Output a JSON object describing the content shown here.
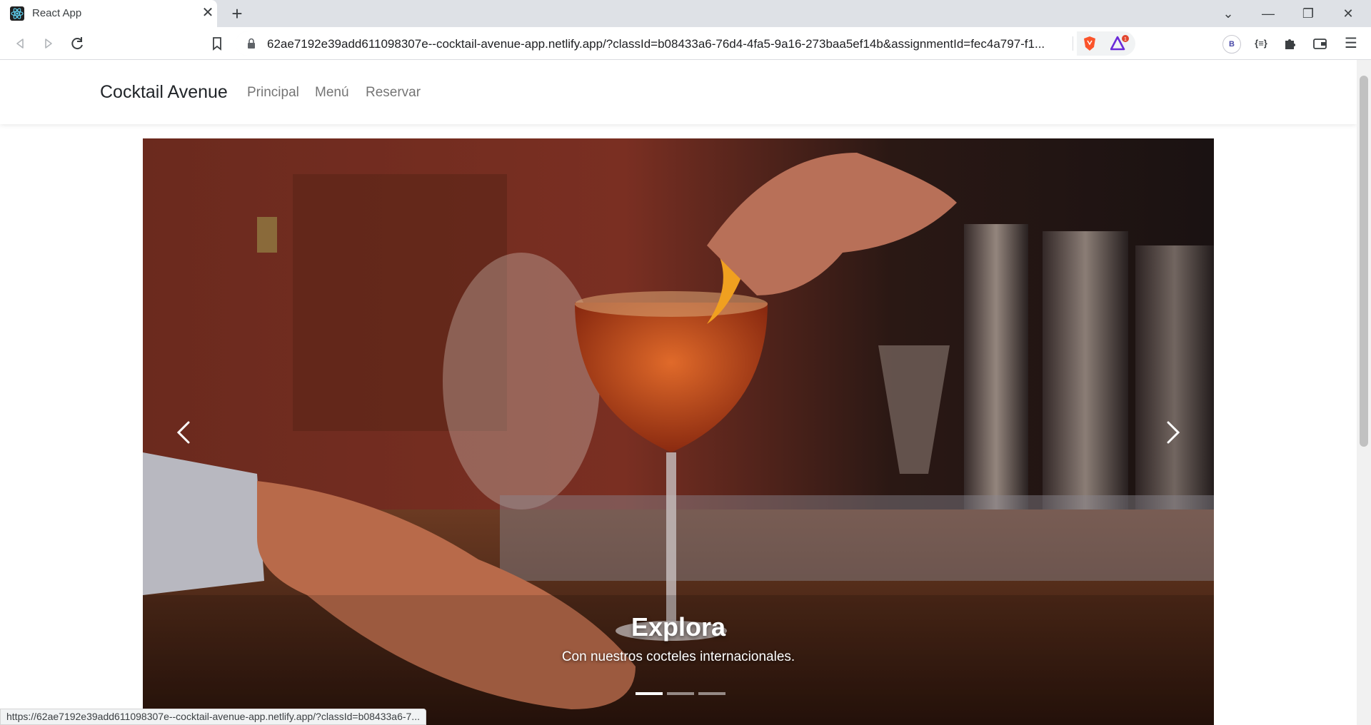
{
  "browser": {
    "tab_title": "React App",
    "url": "62ae7192e39add611098307e--cocktail-avenue-app.netlify.app/?classId=b08433a6-76d4-4fa5-9a16-273baa5ef14b&assignmentId=fec4a797-f1...",
    "rewards_badge": "1",
    "profile_initial": "B",
    "wallet_icon_label": "{≡}",
    "status_url": "https://62ae7192e39add611098307e--cocktail-avenue-app.netlify.app/?classId=b08433a6-7..."
  },
  "navbar": {
    "brand": "Cocktail Avenue",
    "links": [
      "Principal",
      "Menú",
      "Reservar"
    ]
  },
  "carousel": {
    "active_slide": 0,
    "slide_count": 3,
    "caption_title": "Explora",
    "caption_text": "Con nuestros cocteles internacionales."
  },
  "colors": {
    "accent_brave": "#fb542b",
    "text_dark": "#212529",
    "nav_muted": "#737373"
  }
}
